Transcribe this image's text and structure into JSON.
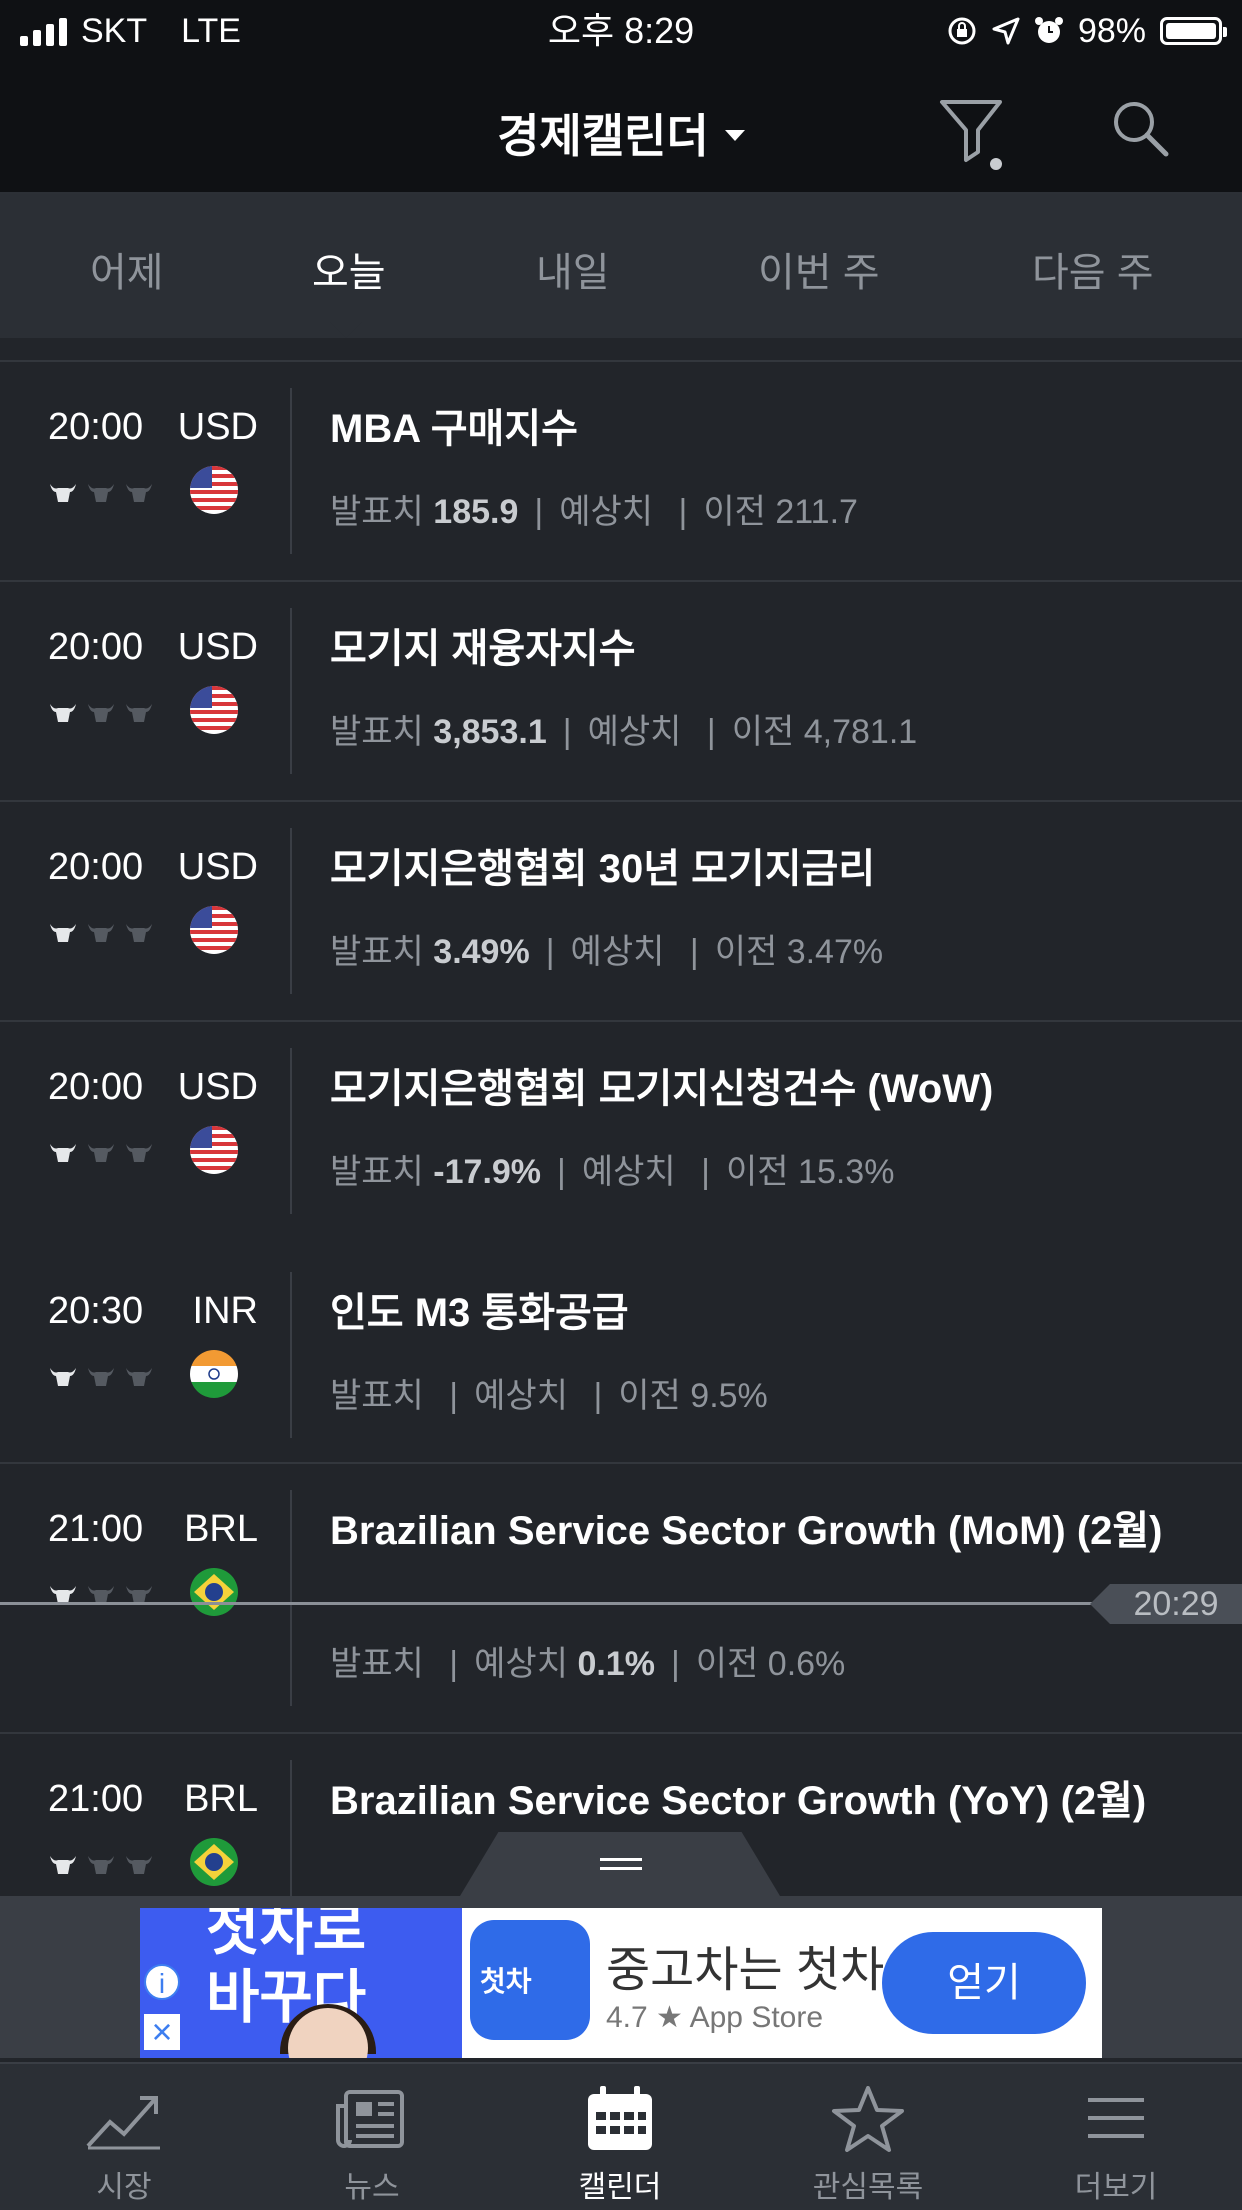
{
  "status_bar": {
    "carrier": "SKT",
    "network": "LTE",
    "time": "오후 8:29",
    "battery": "98%"
  },
  "header": {
    "title": "경제캘린더"
  },
  "tabs": [
    {
      "label": "어제"
    },
    {
      "label": "오늘"
    },
    {
      "label": "내일"
    },
    {
      "label": "이번 주"
    },
    {
      "label": "다음 주"
    }
  ],
  "active_tab": "오늘",
  "events": [
    {
      "time": "20:00",
      "currency": "USD",
      "importance": 1,
      "title": "MBA 구매지수",
      "actual_label": "발표치",
      "actual": "185.9",
      "forecast_label": "예상치",
      "forecast": "",
      "previous_label": "이전",
      "previous": "211.7"
    },
    {
      "time": "20:00",
      "currency": "USD",
      "importance": 1,
      "title": "모기지 재융자지수",
      "actual_label": "발표치",
      "actual": "3,853.1",
      "forecast_label": "예상치",
      "forecast": "",
      "previous_label": "이전",
      "previous": "4,781.1"
    },
    {
      "time": "20:00",
      "currency": "USD",
      "importance": 1,
      "title": "모기지은행협회 30년 모기지금리",
      "actual_label": "발표치",
      "actual": "3.49%",
      "forecast_label": "예상치",
      "forecast": "",
      "previous_label": "이전",
      "previous": "3.47%"
    },
    {
      "time": "20:00",
      "currency": "USD",
      "importance": 1,
      "title": "모기지은행협회 모기지신청건수 (WoW)",
      "actual_label": "발표치",
      "actual": "-17.9%",
      "forecast_label": "예상치",
      "forecast": "",
      "previous_label": "이전",
      "previous": "15.3%"
    },
    {
      "time": "20:30",
      "currency": "INR",
      "importance": 1,
      "title": "인도 M3 통화공급",
      "actual_label": "발표치",
      "actual": "",
      "forecast_label": "예상치",
      "forecast": "",
      "previous_label": "이전",
      "previous": "9.5%"
    },
    {
      "time": "21:00",
      "currency": "BRL",
      "importance": 1,
      "title": "Brazilian Service Sector Growth (MoM) (2월)",
      "actual_label": "발표치",
      "actual": "",
      "forecast_label": "예상치",
      "forecast": "0.1%",
      "previous_label": "이전",
      "previous": "0.6%"
    },
    {
      "time": "21:00",
      "currency": "BRL",
      "importance": 1,
      "title": "Brazilian Service Sector Growth (YoY) (2월)"
    }
  ],
  "now_marker": "20:29",
  "ad": {
    "left_text_line1": "첫차로",
    "left_text_line2": "바꾸다",
    "logo_text": "첫차",
    "headline": "중고차는 첫차",
    "rating": "4.7 ★ App Store",
    "cta": "얻기",
    "info_icon": "info-icon",
    "close_icon": "close-icon"
  },
  "bottom_nav": [
    {
      "label": "시장",
      "icon": "chart-icon"
    },
    {
      "label": "뉴스",
      "icon": "newspaper-icon"
    },
    {
      "label": "캘린더",
      "icon": "calendar-icon"
    },
    {
      "label": "관심목록",
      "icon": "star-icon"
    },
    {
      "label": "더보기",
      "icon": "menu-icon"
    }
  ],
  "active_nav": "캘린더"
}
